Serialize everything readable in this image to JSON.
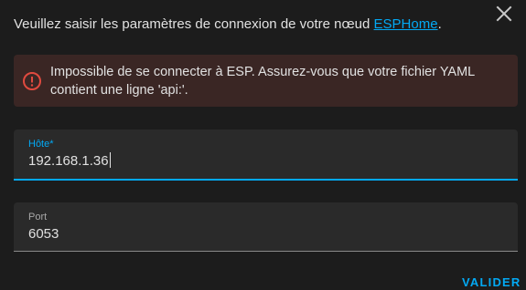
{
  "dialog": {
    "intro_prefix": "Veuillez saisir les paramètres de connexion de votre nœud ",
    "intro_link": "ESPHome",
    "intro_suffix": ".",
    "close_icon": "close-icon"
  },
  "error": {
    "icon": "alert-circle-icon",
    "message": "Impossible de se connecter à ESP. Assurez-vous que votre fichier YAML contient une ligne 'api:'."
  },
  "fields": {
    "host": {
      "label": "Hôte*",
      "value": "192.168.1.36"
    },
    "port": {
      "label": "Port",
      "value": "6053"
    }
  },
  "actions": {
    "submit_label": "VALIDER"
  },
  "colors": {
    "background": "#1c1c1c",
    "accent": "#03a9f4",
    "error": "#e04a3f",
    "error_background": "#3a2624",
    "field_background": "#2a2a2a"
  }
}
